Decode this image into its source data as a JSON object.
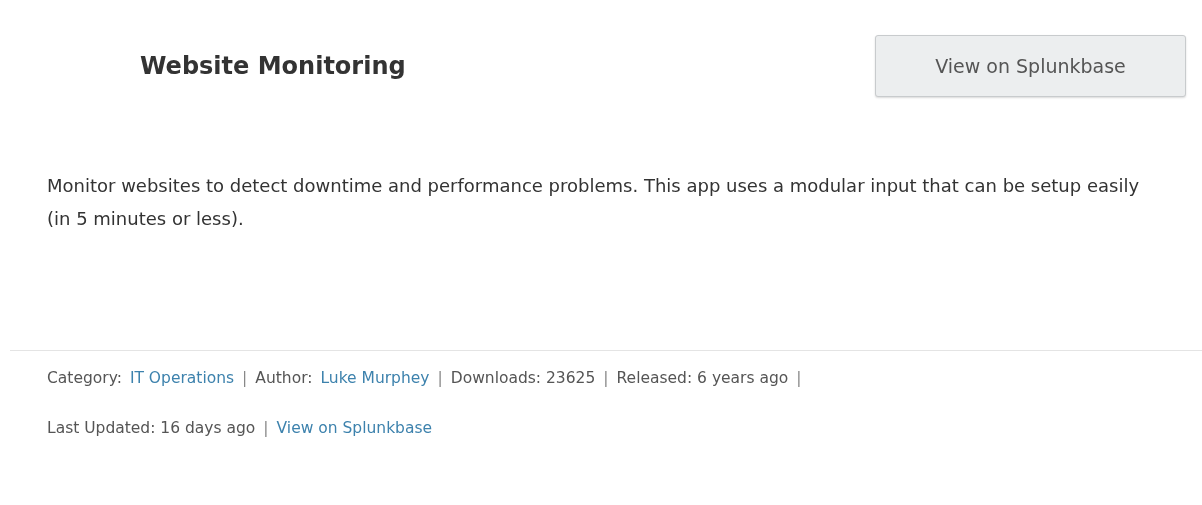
{
  "app": {
    "title": "Website Monitoring",
    "button": "View on Splunkbase"
  },
  "description": "Monitor websites to detect downtime and performance problems. This app uses a modular input that can be setup easily (in 5 minutes or less).",
  "meta_lines": [
    [
      {
        "kind": "label",
        "text": "Category:"
      },
      {
        "kind": "link",
        "text": "IT Operations"
      },
      {
        "kind": "sep",
        "text": "|"
      },
      {
        "kind": "label",
        "text": "Author:"
      },
      {
        "kind": "link",
        "text": "Luke Murphey"
      },
      {
        "kind": "sep",
        "text": "|"
      },
      {
        "kind": "label",
        "text": "Downloads: 23625"
      },
      {
        "kind": "sep",
        "text": "|"
      },
      {
        "kind": "label",
        "text": "Released: 6 years ago"
      },
      {
        "kind": "sep",
        "text": "|"
      }
    ],
    [
      {
        "kind": "label",
        "text": "Last Updated:  16 days ago"
      },
      {
        "kind": "sep",
        "text": "|"
      },
      {
        "kind": "link",
        "text": "View on Splunkbase"
      }
    ]
  ]
}
